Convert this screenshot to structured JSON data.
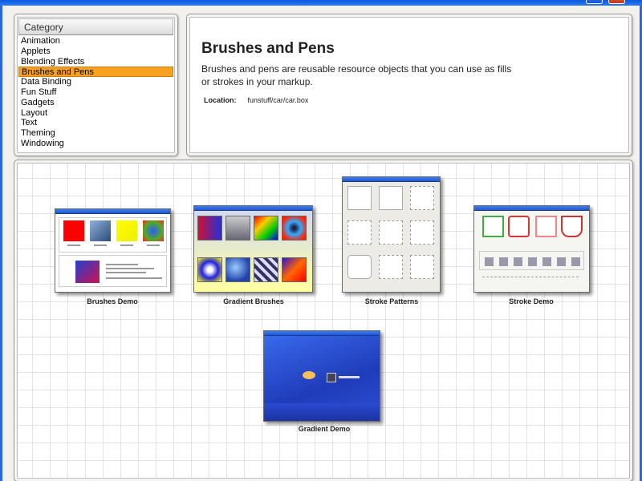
{
  "window": {
    "minimize_label": "_",
    "close_label": "x"
  },
  "category": {
    "header": "Category",
    "items": [
      {
        "label": "Animation",
        "selected": false
      },
      {
        "label": "Applets",
        "selected": false
      },
      {
        "label": "Blending Effects",
        "selected": false
      },
      {
        "label": "Brushes and Pens",
        "selected": true
      },
      {
        "label": "Data Binding",
        "selected": false
      },
      {
        "label": "Fun Stuff",
        "selected": false
      },
      {
        "label": "Gadgets",
        "selected": false
      },
      {
        "label": "Layout",
        "selected": false
      },
      {
        "label": "Text",
        "selected": false
      },
      {
        "label": "Theming",
        "selected": false
      },
      {
        "label": "Windowing",
        "selected": false
      }
    ]
  },
  "description": {
    "title": "Brushes and Pens",
    "text": "Brushes and pens are reusable resource objects that you can use as fills or strokes in your markup.",
    "location_label": "Location:",
    "location_value": "funstuff/car/car.box"
  },
  "demos": [
    {
      "label": "Brushes Demo"
    },
    {
      "label": "Gradient Brushes"
    },
    {
      "label": "Stroke Patterns"
    },
    {
      "label": "Stroke Demo"
    },
    {
      "label": "Gradient Demo"
    }
  ],
  "colors": {
    "selection": "#f7a11e",
    "titlebar": "#0a58e0",
    "demo_blue": "#2448c8"
  }
}
